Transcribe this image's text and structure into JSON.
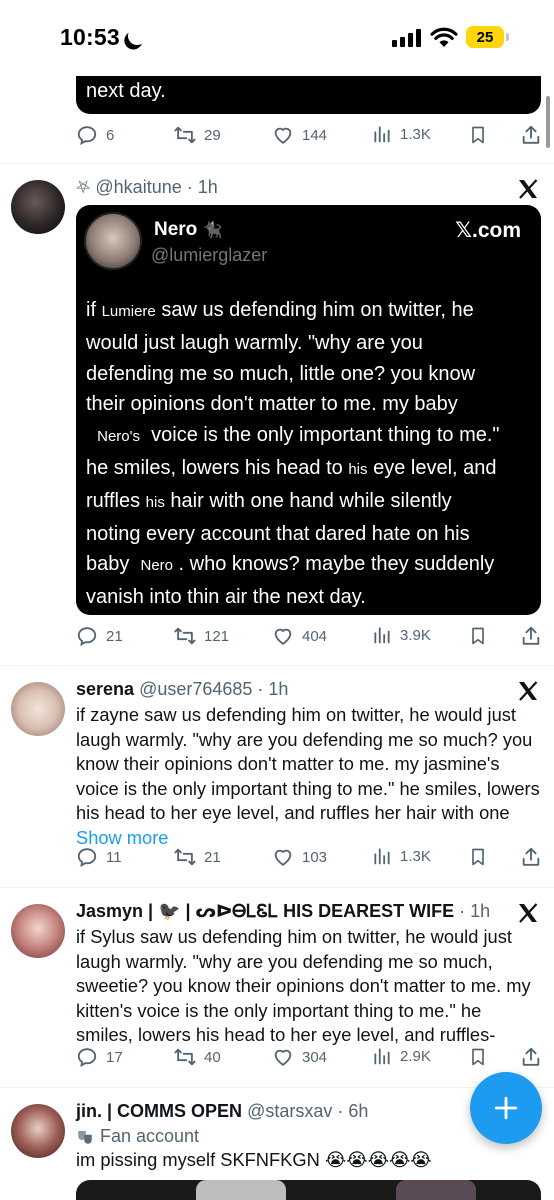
{
  "status_bar": {
    "time": "10:53",
    "battery": "25"
  },
  "top_card": {
    "text_tail": "next day."
  },
  "tweets": [
    {
      "actions": {
        "replies": "6",
        "reposts": "29",
        "likes": "144",
        "views": "1.3K"
      }
    },
    {
      "display_name": "⛧ @hkaitune",
      "time": "1h",
      "quote": {
        "name": "Nero",
        "name_emoji": "🐈‍⬛",
        "handle": "@lumierglazer",
        "site": "𝕏.com",
        "text": [
          {
            "pre": "if ",
            "small": "Lumiere",
            "post": " saw us defending him on twitter, he"
          },
          {
            "pre": "would just laugh warmly. \"why are you",
            "small": "",
            "post": ""
          },
          {
            "pre": "defending me so much, little one? you know",
            "small": "",
            "post": ""
          },
          {
            "pre": "their opinions don't matter to me. my baby",
            "small": "",
            "post": ""
          },
          {
            "pre": "  ",
            "small": "Nero's",
            "post": "  voice is the only important thing to me.\""
          },
          {
            "pre": "he smiles, lowers his head to ",
            "small": "his",
            "post": " eye level, and"
          },
          {
            "pre": "ruffles ",
            "small": "his",
            "post": " hair with one hand while silently"
          },
          {
            "pre": "noting every account that dared hate on his",
            "small": "",
            "post": ""
          },
          {
            "pre": "baby  ",
            "small": "Nero",
            "post": " . who knows? maybe they suddenly"
          },
          {
            "pre": "vanish into thin air the next day.",
            "small": "",
            "post": ""
          }
        ]
      },
      "actions": {
        "replies": "21",
        "reposts": "121",
        "likes": "404",
        "views": "3.9K"
      }
    },
    {
      "display_name": "serena",
      "handle": "@user764685",
      "time": "1h",
      "text": "if zayne saw us defending him on twitter, he would just laugh warmly. \"why are you defending me so much? you know their opinions don't matter to me. my jasmine's voice is the only important thing to me.\" he smiles, lowers his head to her eye level, and ruffles her hair with one ",
      "show_more": "Show more",
      "actions": {
        "replies": "11",
        "reposts": "21",
        "likes": "103",
        "views": "1.3K"
      }
    },
    {
      "display_name": "Jasmyn | 🐦‍⬛ | ᔕᐅᎾᏞᏋᏞ HIS DEAREST WIFE",
      "time": "1h",
      "text": "if Sylus saw us defending him on twitter, he would just laugh warmly. \"why are you defending me so much, sweetie? you know their opinions don't matter to me. my kitten's voice is the only important thing to me.\" he smiles, lowers his head to her eye level, and ruffles-",
      "actions": {
        "replies": "17",
        "reposts": "40",
        "likes": "304",
        "views": "2.9K"
      }
    },
    {
      "display_name": "jin. | COMMS OPEN",
      "handle": "@starsxav",
      "time": "6h",
      "label": "Fan account",
      "text": "im pissing myself SKFNFKGN 😭😭😭😭😭"
    }
  ]
}
